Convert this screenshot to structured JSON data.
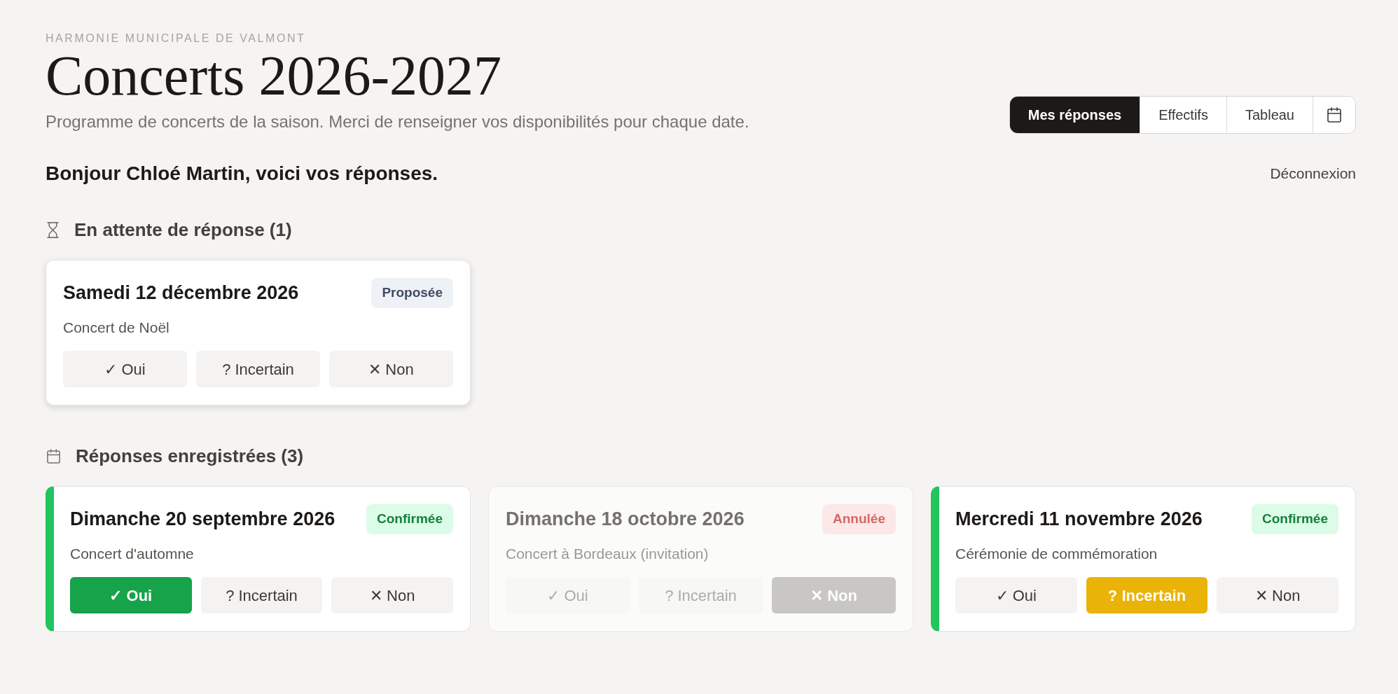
{
  "header": {
    "organization": "HARMONIE MUNICIPALE DE VALMONT",
    "title": "Concerts 2026-2027",
    "subtitle": "Programme de concerts de la saison. Merci de renseigner vos disponibilités pour chaque date."
  },
  "nav_tabs": [
    {
      "kind": "text",
      "label": "Mes réponses",
      "selected": true
    },
    {
      "kind": "text",
      "label": "Effectifs",
      "selected": false
    },
    {
      "kind": "text",
      "label": "Tableau",
      "selected": false
    },
    {
      "kind": "icon",
      "selected": false
    }
  ],
  "greeting": "Bonjour Chloé Martin, voici vos réponses.",
  "logout_link": "Déconnexion",
  "sections": [
    {
      "kind": "pending",
      "heading": "En attente de réponse (1)",
      "events": [
        {
          "date": "Samedi 12 décembre 2026",
          "name": "Concert de Noël",
          "status": {
            "kind": "proposed",
            "label": "Proposée"
          },
          "responses": [
            {
              "kind": "yes",
              "label": "✓ Oui",
              "selected": false
            },
            {
              "kind": "maybe",
              "label": "? Incertain",
              "selected": false
            },
            {
              "kind": "no",
              "label": "✕ Non",
              "selected": false
            }
          ]
        }
      ]
    },
    {
      "kind": "recorded",
      "heading": "Réponses enregistrées (3)",
      "events": [
        {
          "date": "Dimanche 20 septembre 2026",
          "name": "Concert d'automne",
          "status": {
            "kind": "confirmed",
            "label": "Confirmée"
          },
          "responses": [
            {
              "kind": "yes",
              "label": "✓ Oui",
              "selected": true
            },
            {
              "kind": "maybe",
              "label": "? Incertain",
              "selected": false
            },
            {
              "kind": "no",
              "label": "✕ Non",
              "selected": false
            }
          ]
        },
        {
          "date": "Dimanche 18 octobre 2026",
          "name": "Concert à Bordeaux (invitation)",
          "status": {
            "kind": "cancelled",
            "label": "Annulée"
          },
          "responses": [
            {
              "kind": "yes",
              "label": "✓ Oui",
              "selected": false
            },
            {
              "kind": "maybe",
              "label": "? Incertain",
              "selected": false
            },
            {
              "kind": "no",
              "label": "✕ Non",
              "selected": true
            }
          ]
        },
        {
          "date": "Mercredi 11 novembre 2026",
          "name": "Cérémonie de commémoration",
          "status": {
            "kind": "confirmed",
            "label": "Confirmée"
          },
          "responses": [
            {
              "kind": "yes",
              "label": "✓ Oui",
              "selected": false
            },
            {
              "kind": "maybe",
              "label": "? Incertain",
              "selected": true
            },
            {
              "kind": "no",
              "label": "✕ Non",
              "selected": false
            }
          ]
        }
      ]
    }
  ]
}
